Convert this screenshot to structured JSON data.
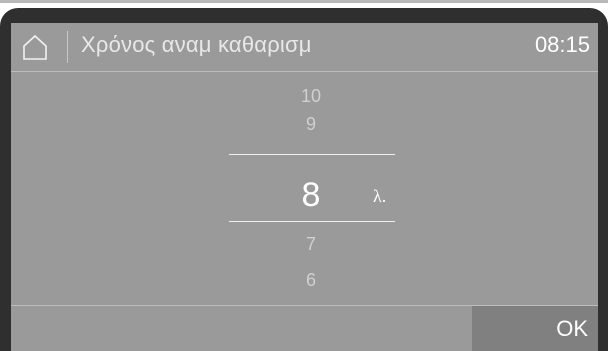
{
  "header": {
    "title": "Χρόνος αναμ καθαρισμ",
    "clock": "08:15",
    "home_icon": "home-icon"
  },
  "picker": {
    "values_above": [
      "10",
      "9"
    ],
    "selected_value": "8",
    "unit": "λ.",
    "values_below": [
      "7",
      "6"
    ]
  },
  "footer": {
    "ok_label": "OK"
  },
  "colors": {
    "frame": "#2f2f2f",
    "screen_bg": "#9a9a9a",
    "ok_bg": "#808080",
    "text_primary": "#ffffff",
    "text_dim": "#d0d0d0"
  }
}
